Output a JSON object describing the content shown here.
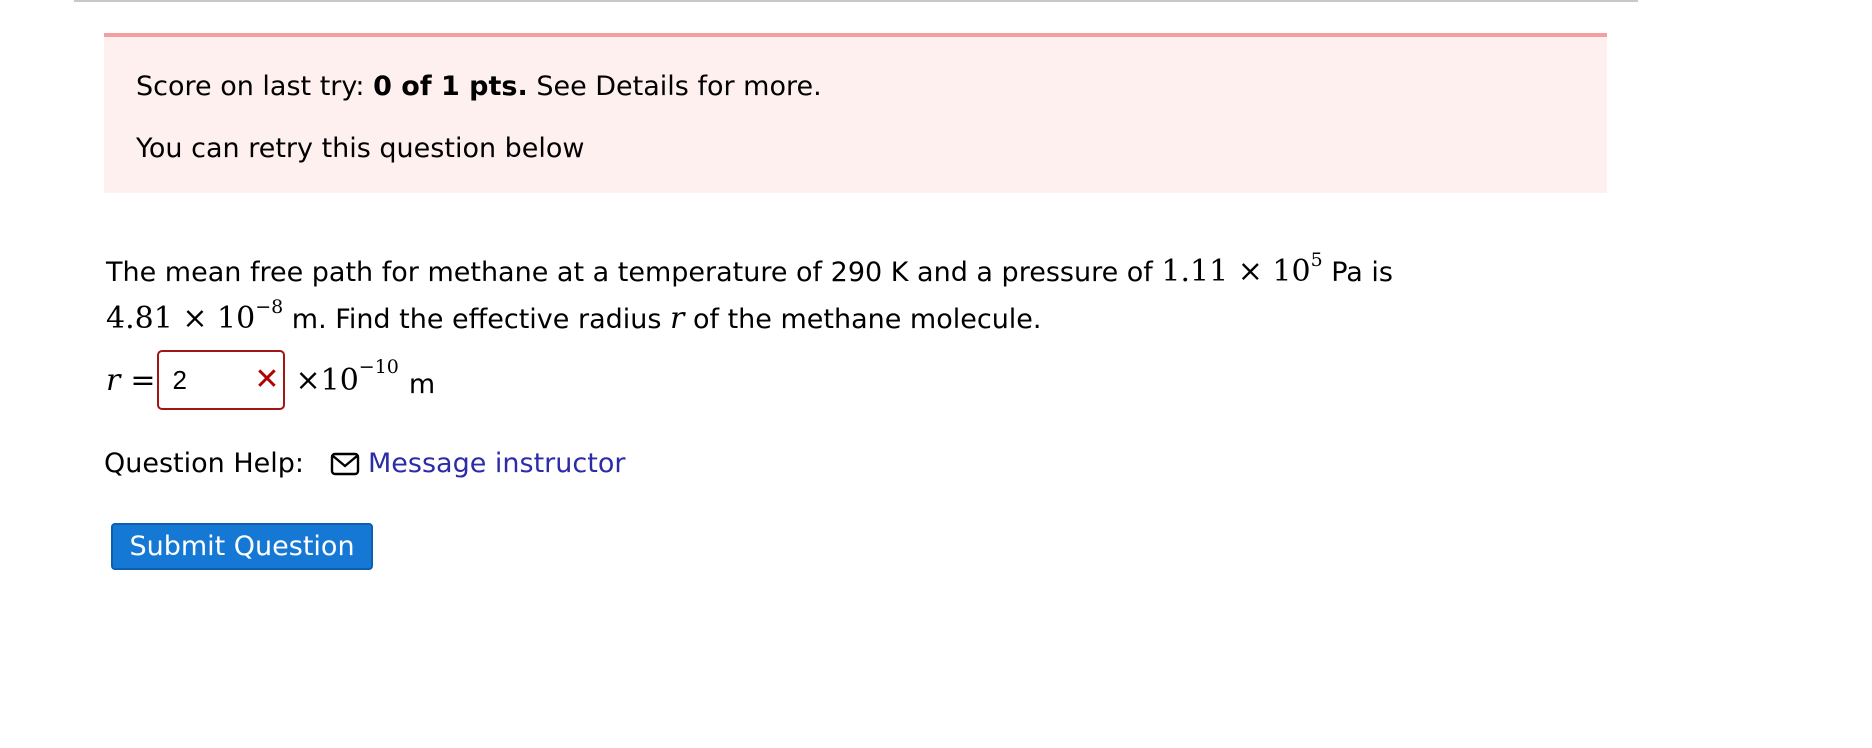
{
  "score": {
    "prefix": "Score on last try: ",
    "points": "0 of 1 pts.",
    "suffix": " See Details for more.",
    "retry_message": "You can retry this question below"
  },
  "question": {
    "line1_text": "The mean free path for methane at a temperature of 290 K and a pressure of ",
    "pressure_mantissa": "1.11 × 10",
    "pressure_exponent": "5",
    "line1_end": " Pa is",
    "path_mantissa": "4.81 × 10",
    "path_exponent": "−8",
    "line2_text": " m. Find the effective radius ",
    "radius_symbol": "r",
    "line2_end": " of the methane molecule."
  },
  "answer": {
    "label": "r",
    "equals": "=",
    "value": "2",
    "status": "incorrect",
    "status_icon": "x-mark-icon",
    "status_glyph": "✕",
    "multiplier": "×10",
    "exponent": "−10",
    "unit": "m"
  },
  "help": {
    "label": "Question Help:",
    "link_icon": "mail-icon",
    "link_text": "Message instructor"
  },
  "submit": {
    "label": "Submit Question"
  },
  "colors": {
    "score_box_bg": "#fff0f0",
    "score_box_border": "#f4a0a0",
    "error": "#b30000",
    "link": "#2c2ca8",
    "button": "#1478d4"
  }
}
